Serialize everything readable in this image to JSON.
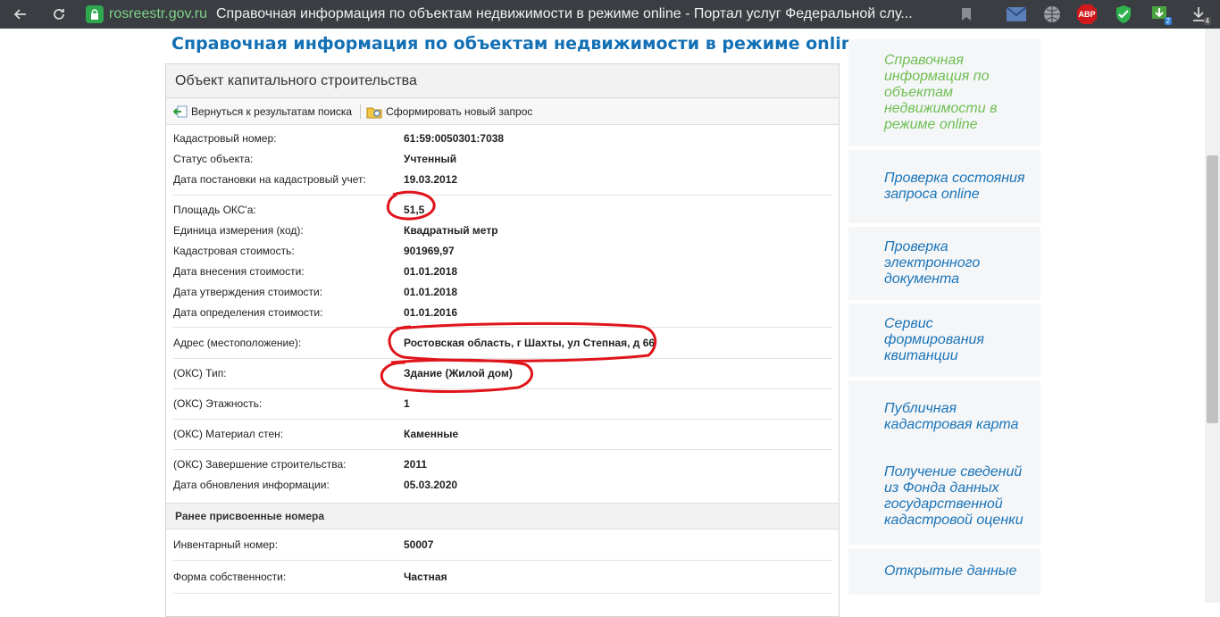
{
  "browser": {
    "url_host": "rosreestr.gov.ru",
    "tab_title": "Справочная информация по объектам недвижимости в режиме online - Портал услуг Федеральной слу...",
    "abp_label": "ABP",
    "ext_badge_1": "2",
    "ext_badge_2": "4"
  },
  "page": {
    "title": "Справочная информация по объектам недвижимости в режиме online"
  },
  "panel": {
    "header": "Объект капитального строительства",
    "toolbar": {
      "back_label": "Вернуться к результатам поиска",
      "new_query_label": "Сформировать новый запрос"
    },
    "rows": [
      {
        "label": "Кадастровый номер:",
        "value": "61:59:0050301:7038"
      },
      {
        "label": "Статус объекта:",
        "value": "Учтенный"
      },
      {
        "label": "Дата постановки на кадастровый учет:",
        "value": "19.03.2012"
      },
      {
        "label": "Площадь ОКС'а:",
        "value": "51,5"
      },
      {
        "label": "Единица измерения (код):",
        "value": "Квадратный метр"
      },
      {
        "label": "Кадастровая стоимость:",
        "value": "901969,97"
      },
      {
        "label": "Дата внесения стоимости:",
        "value": "01.01.2018"
      },
      {
        "label": "Дата утверждения стоимости:",
        "value": "01.01.2018"
      },
      {
        "label": "Дата определения стоимости:",
        "value": "01.01.2016"
      },
      {
        "label": "Адрес (местоположение):",
        "value": "Ростовская область, г Шахты, ул Степная, д 66"
      },
      {
        "label": "(ОКС) Тип:",
        "value": "Здание (Жилой дом)"
      },
      {
        "label": "(ОКС) Этажность:",
        "value": "1"
      },
      {
        "label": "(ОКС) Материал стен:",
        "value": "Каменные"
      },
      {
        "label": "(ОКС) Завершение строительства:",
        "value": "2011"
      },
      {
        "label": "Дата обновления информации:",
        "value": "05.03.2020"
      }
    ],
    "section_title": "Ранее присвоенные номера",
    "extra_rows": [
      {
        "label": "Инвентарный номер:",
        "value": "50007"
      },
      {
        "label": "Форма собственности:",
        "value": "Частная"
      }
    ]
  },
  "sidebar": {
    "items": [
      {
        "label": "Справочная информация по объектам недвижимости в режиме online"
      },
      {
        "label": "Проверка состояния запроса online"
      },
      {
        "label": "Проверка электронного документа"
      },
      {
        "label": "Сервис формирования квитанции"
      },
      {
        "label": "Публичная кадастровая карта"
      },
      {
        "label": "Получение сведений из Фонда данных государственной кадастровой оценки"
      },
      {
        "label": "Открытые данные"
      }
    ]
  },
  "colors": {
    "title_blue": "#1370b5",
    "link_blue": "#1b74b8",
    "active_green": "#6fbf52",
    "annotation_red": "#e0141b"
  }
}
